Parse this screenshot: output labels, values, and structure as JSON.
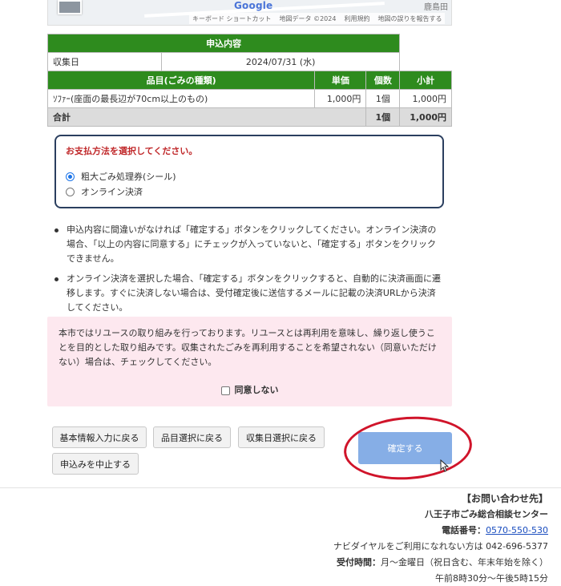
{
  "map": {
    "google": "Google",
    "place": "鹿島田",
    "attribution": [
      "キーボード ショートカット",
      "地図データ ©2024",
      "利用規約",
      "地図の誤りを報告する"
    ]
  },
  "order": {
    "section_title": "申込内容",
    "date_label": "収集日",
    "date_value": "2024/07/31 (水)",
    "headers": {
      "item": "品目(ごみの種類)",
      "price": "単価",
      "qty": "個数",
      "subtotal": "小計"
    },
    "row": {
      "item": "ｿﾌｧｰ(座面の最長辺が70cm以上のもの)",
      "price": "1,000円",
      "qty": "1個",
      "subtotal": "1,000円"
    },
    "total": {
      "label": "合計",
      "qty": "1個",
      "amount": "1,000円"
    }
  },
  "payment": {
    "title": "お支払方法を選択してください。",
    "options": [
      {
        "label": "粗大ごみ処理券(シール)",
        "selected": true
      },
      {
        "label": "オンライン決済",
        "selected": false
      }
    ]
  },
  "notes": [
    "申込内容に間違いがなければ「確定する」ボタンをクリックしてください。オンライン決済の場合、「以上の内容に同意する」にチェックが入っていないと、「確定する」ボタンをクリックできません。",
    "オンライン決済を選択した場合、「確定する」ボタンをクリックすると、自動的に決済画面に遷移します。すぐに決済しない場合は、受付確定後に送信するメールに記載の決済URLから決済してください。"
  ],
  "reuse": {
    "text": "本市ではリユースの取り組みを行っております。リユースとは再利用を意味し、繰り返し使うことを目的とした取り組みです。収集されたごみを再利用することを希望されない（同意いただけない）場合は、チェックしてください。",
    "checkbox_label": "同意しない"
  },
  "buttons": {
    "back_basic": "基本情報入力に戻る",
    "back_item": "品目選択に戻る",
    "back_date": "収集日選択に戻る",
    "cancel": "申込みを中止する",
    "confirm": "確定する"
  },
  "footer": {
    "heading": "【お問い合わせ先】",
    "org": "八王子市ごみ総合相談センター",
    "phone_label": "電話番号：",
    "phone": "0570-550-530",
    "navi_note": "ナビダイヤルをご利用になれない方は 042-696-5377",
    "hours_label": "受付時間：",
    "hours_days": "月～金曜日（祝日含む、年末年始を除く）",
    "hours_time": "午前8時30分～午後5時15分"
  },
  "colors": {
    "table_header": "#2e8b1e",
    "pay_title": "#c0282a",
    "confirm_button": "#86aee6",
    "annotation": "#d0142a",
    "reuse_background": "#fde8ef"
  }
}
